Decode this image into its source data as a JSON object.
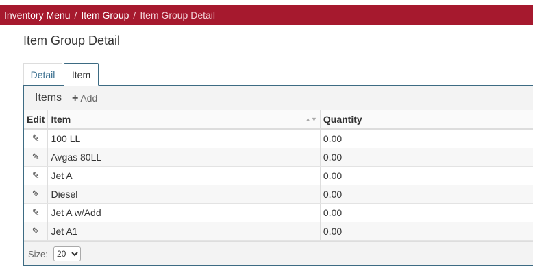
{
  "breadcrumb": {
    "items": [
      "Inventory Menu",
      "Item Group"
    ],
    "separator": "/",
    "current": "Item Group Detail"
  },
  "page": {
    "title": "Item Group Detail"
  },
  "tabs": [
    {
      "label": "Detail",
      "active": false
    },
    {
      "label": "Item",
      "active": true
    }
  ],
  "panel": {
    "title": "Items",
    "add_label": "Add"
  },
  "table": {
    "columns": [
      "Edit",
      "Item",
      "Quantity"
    ],
    "rows": [
      {
        "item": "100 LL",
        "quantity": "0.00"
      },
      {
        "item": "Avgas 80LL",
        "quantity": "0.00"
      },
      {
        "item": "Jet A",
        "quantity": "0.00"
      },
      {
        "item": "Diesel",
        "quantity": "0.00"
      },
      {
        "item": "Jet A w/Add",
        "quantity": "0.00"
      },
      {
        "item": "Jet A1",
        "quantity": "0.00"
      }
    ]
  },
  "pager": {
    "size_label": "Size:",
    "size_value": "20"
  },
  "colors": {
    "brand": "#a6192e",
    "panel_border": "#3d6b83",
    "tab_link": "#3a6f8f"
  }
}
